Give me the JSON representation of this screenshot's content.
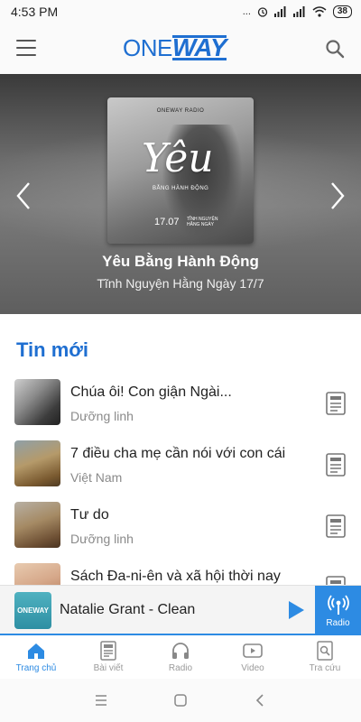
{
  "status_bar": {
    "time": "4:53 PM",
    "signal_text": "...",
    "battery": "38"
  },
  "header": {
    "logo_one": "ONE",
    "logo_way": "WAY",
    "menu_icon": "hamburger-menu-icon",
    "search_icon": "search-icon"
  },
  "hero": {
    "cover_brand": "ONEWAY RADIO",
    "cover_title": "Yêu",
    "cover_subtitle": "BẰNG HÀNH ĐỘNG",
    "cover_date": "17.07",
    "cover_date_note": "TĨNH NGUYỆN HẰNG NGÀY",
    "title": "Yêu Bằng Hành Động",
    "subtitle": "Tĩnh Nguyện Hằng Ngày 17/7"
  },
  "news": {
    "section_title": "Tin mới",
    "items": [
      {
        "title": "Chúa ôi! Con giận Ngài...",
        "category": "Dưỡng linh"
      },
      {
        "title": "7 điều cha mẹ cần nói với con cái",
        "category": "Việt Nam"
      },
      {
        "title": "Tư do",
        "category": "Dưỡng linh"
      },
      {
        "title": "Sách Đa-ni-ên và xã hội thời nay",
        "category": ""
      }
    ]
  },
  "player": {
    "thumb_text": "ONEWAY",
    "title": "Natalie Grant - Clean",
    "radio_label": "Radio"
  },
  "tabs": [
    {
      "label": "Trang chủ",
      "icon": "home-icon",
      "active": true
    },
    {
      "label": "Bài viết",
      "icon": "article-icon",
      "active": false
    },
    {
      "label": "Radio",
      "icon": "headphones-icon",
      "active": false
    },
    {
      "label": "Video",
      "icon": "video-icon",
      "active": false
    },
    {
      "label": "Tra cứu",
      "icon": "lookup-icon",
      "active": false
    }
  ],
  "colors": {
    "accent": "#2d8be3",
    "brand": "#1f6fd1"
  }
}
